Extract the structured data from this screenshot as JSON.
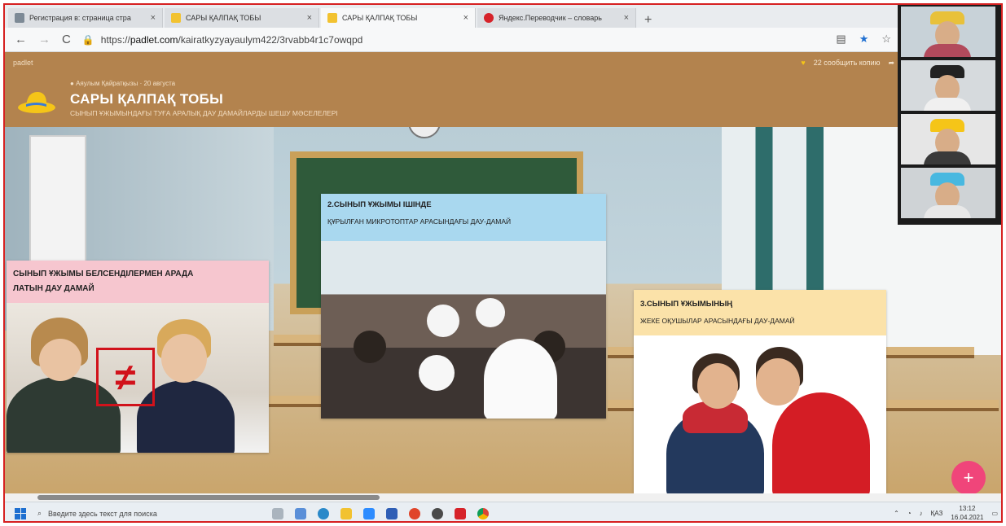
{
  "browser": {
    "tabs": [
      {
        "label": "Регистрация в: страница стра",
        "active": false
      },
      {
        "label": "САРЫ ҚАЛПАҚ ТОБЫ",
        "active": false
      },
      {
        "label": "САРЫ ҚАЛПАҚ ТОБЫ",
        "active": true
      },
      {
        "label": "Яндекс.Переводчик – словарь",
        "active": false
      }
    ],
    "url_prefix": "https://",
    "url_host": "padlet.com",
    "url_path": "/kairatkyzyayaulym422/3rvabb4r1c7owqpd"
  },
  "padlet": {
    "brand": "padlet",
    "author": "Аяулым Қайратқызы",
    "date": "20 августа",
    "likes_text": "22 сообщить копию",
    "title": "САРЫ ҚАЛПАҚ ТОБЫ",
    "subtitle": "СЫНЫП ҰЖЫМЫНДАҒЫ ТУҒА АРАЛЫҚ ДАУ ДАМАЙЛАРДЫ ШЕШУ МӘСЕЛЕЛЕРІ"
  },
  "cards": [
    {
      "title": "СЫНЫП ҰЖЫМЫ БЕЛСЕНДІЛЕРМЕН АРАДА",
      "subtitle": "ЛАТЫН ДАУ ДАМАЙ"
    },
    {
      "title": "2.СЫНЫП ҰЖЫМЫ ІШІНДЕ",
      "subtitle": "ҚҰРЫЛҒАН МИКРОТОПТАР АРАСЫНДАҒЫ ДАУ-ДАМАЙ"
    },
    {
      "title": "3.СЫНЫП ҰЖЫМЫНЫҢ",
      "subtitle": "ЖЕКЕ ОҚУШЫЛАР АРАСЫНДАҒЫ ДАУ-ДАМАЙ"
    }
  ],
  "fab_label": "+",
  "taskbar": {
    "search_placeholder": "Введите здесь текст для поиска",
    "lang": "ҚАЗ",
    "time": "13:12",
    "date": "16.04.2021"
  }
}
